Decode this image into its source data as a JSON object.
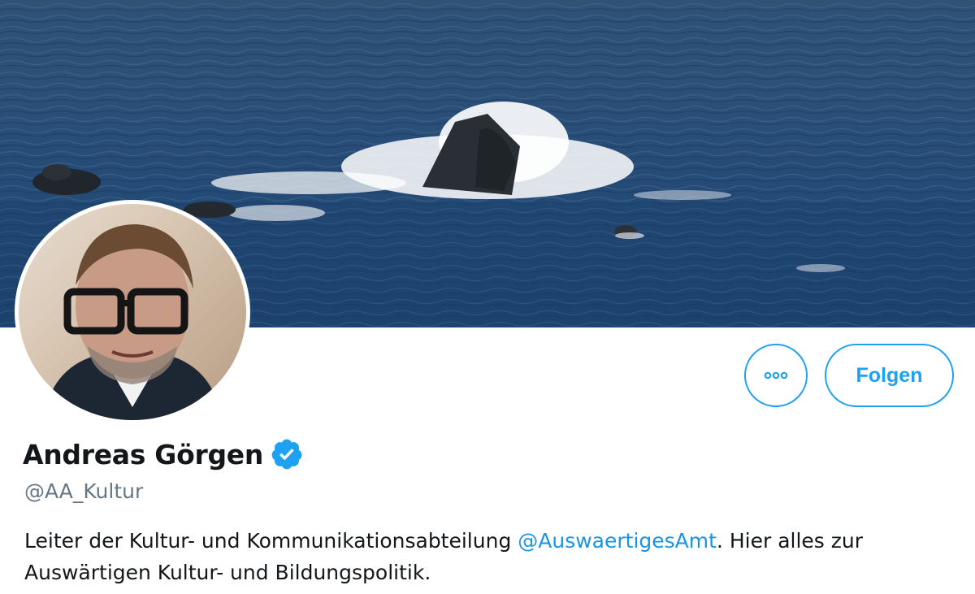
{
  "profile": {
    "name": "Andreas Görgen",
    "handle": "@AA_Kultur",
    "verified": true,
    "bio_before": "Leiter der Kultur- und Kommunikationsabteilung ",
    "bio_mention": "@AuswaertigesAmt",
    "bio_after": ". Hier alles zur Auswärtigen Kultur- und Bildungspolitik."
  },
  "actions": {
    "more_icon": "more-dots-icon",
    "follow_label": "Folgen"
  },
  "colors": {
    "accent": "#1da1f2",
    "mention": "#1b95e0",
    "text": "#14171a",
    "secondary": "#657786"
  }
}
